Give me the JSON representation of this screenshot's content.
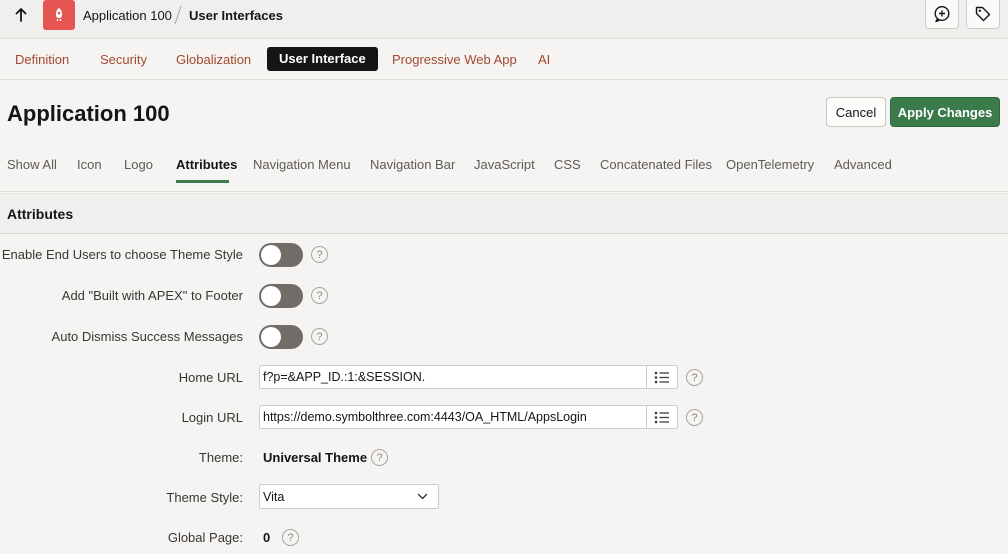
{
  "topbar": {
    "app_crumb": "Application 100",
    "current_crumb": "User Interfaces"
  },
  "primary_tabs": [
    {
      "label": "Definition"
    },
    {
      "label": "Security"
    },
    {
      "label": "Globalization"
    },
    {
      "label": "User Interface"
    },
    {
      "label": "Progressive Web App"
    },
    {
      "label": "AI"
    }
  ],
  "header": {
    "title": "Application 100",
    "cancel_label": "Cancel",
    "apply_label": "Apply Changes"
  },
  "sub_tabs": [
    {
      "label": "Show All"
    },
    {
      "label": "Icon"
    },
    {
      "label": "Logo"
    },
    {
      "label": "Attributes"
    },
    {
      "label": "Navigation Menu"
    },
    {
      "label": "Navigation Bar"
    },
    {
      "label": "JavaScript"
    },
    {
      "label": "CSS"
    },
    {
      "label": "Concatenated Files"
    },
    {
      "label": "OpenTelemetry"
    },
    {
      "label": "Advanced"
    }
  ],
  "region": {
    "title": "Attributes"
  },
  "form": {
    "enable_theme_style_label": "Enable End Users to choose Theme Style",
    "built_with_apex_label": "Add \"Built with APEX\" to Footer",
    "auto_dismiss_label": "Auto Dismiss Success Messages",
    "home_url_label": "Home URL",
    "home_url_value": "f?p=&APP_ID.:1:&SESSION.",
    "login_url_label": "Login URL",
    "login_url_value": "https://demo.symbolthree.com:4443/OA_HTML/AppsLogin",
    "theme_label": "Theme:",
    "theme_value": "Universal Theme",
    "theme_style_label": "Theme Style:",
    "theme_style_value": "Vita",
    "global_page_label": "Global Page:",
    "global_page_value": "0",
    "help_glyph": "?"
  },
  "colors": {
    "accent_active_tab": "#161513",
    "apply_button": "#3b7a4b",
    "link_tab": "#a1492f",
    "app_badge": "#e55552",
    "toggle_off": "#716c67"
  },
  "icons": {
    "up": "arrow-up-icon",
    "app": "app-rocket-icon",
    "comment": "add-comment-icon",
    "tag": "tag-icon",
    "list": "list-icon",
    "chevron": "chevron-down-icon",
    "help": "help-icon"
  }
}
